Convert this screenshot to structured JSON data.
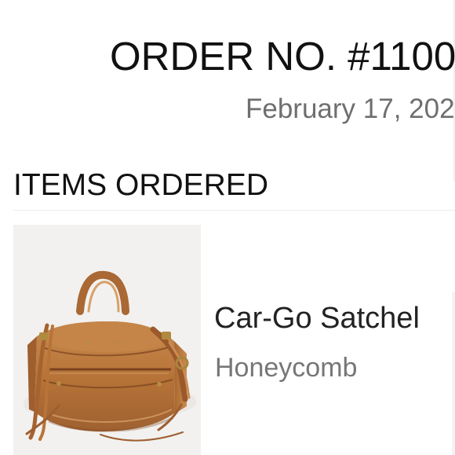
{
  "order": {
    "number_text": "ORDER NO. #1100",
    "date_text": "February 17, 202"
  },
  "items_section": {
    "title": "ITEMS ORDERED",
    "items": [
      {
        "name": "Car-Go Satchel",
        "variant": "Honeycomb",
        "image_icon": "leather-satchel-image"
      }
    ]
  },
  "colors": {
    "background": "#ffffff",
    "text_primary": "#111111",
    "text_secondary": "#777777",
    "divider": "#ececec",
    "product_background": "#f2f1ef",
    "leather": "#b87a43"
  }
}
